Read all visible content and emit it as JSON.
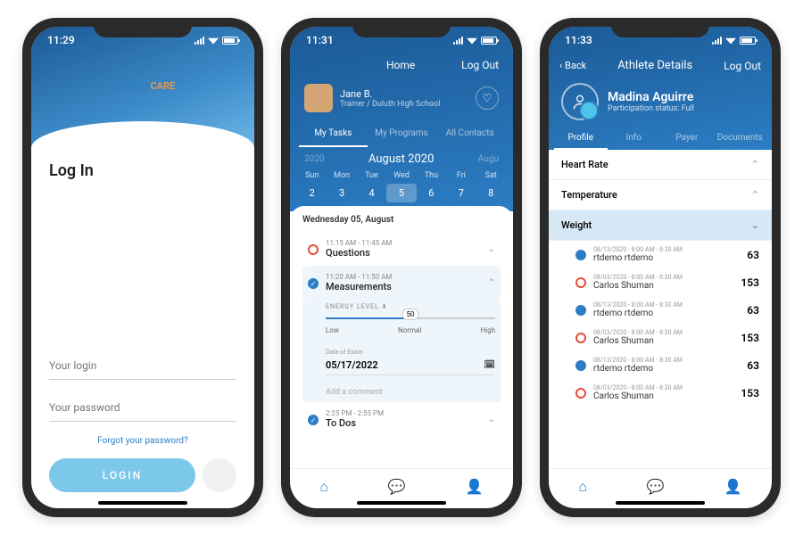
{
  "p1": {
    "time": "11:29",
    "logo_a": "Compete",
    "logo_b": "CARE",
    "title": "Log In",
    "login_ph": "Your login",
    "pass_ph": "Your password",
    "forgot": "Forgot your password?",
    "login_btn": "LOGIN"
  },
  "p2": {
    "time": "11:31",
    "home": "Home",
    "logout": "Log Out",
    "user": {
      "name": "Jane B.",
      "role": "Trainer",
      "school": "Duluth High School"
    },
    "tabs": [
      "My Tasks",
      "My Programs",
      "All Contacts"
    ],
    "month": "August 2020",
    "prev": "2020",
    "next": "Augu",
    "dow": [
      "Sun",
      "Mon",
      "Tue",
      "Wed",
      "Thu",
      "Fri",
      "Sat"
    ],
    "days": [
      "2",
      "3",
      "4",
      "5",
      "6",
      "7",
      "8"
    ],
    "date_label": "Wednesday 05, August",
    "tasks": [
      {
        "time": "11:15 AM - 11:45 AM",
        "title": "Questions"
      },
      {
        "time": "11:20 AM - 11:50 AM",
        "title": "Measurements"
      },
      {
        "time": "2:25 PM - 2:55 PM",
        "title": "To Dos"
      }
    ],
    "energy": {
      "label": "ENERGY LEVEL",
      "val": "50",
      "low": "Low",
      "normal": "Normal",
      "high": "High"
    },
    "exam": {
      "label": "Date of Exam",
      "date": "05/17/2022"
    },
    "add": "Add a comment"
  },
  "p3": {
    "time": "11:33",
    "back": "Back",
    "title": "Athlete Details",
    "logout": "Log Out",
    "name": "Madina Aguirre",
    "status_l": "Participation status:",
    "status_v": "Full",
    "tabs": [
      "Profile",
      "Info",
      "Payer",
      "Documents"
    ],
    "accordions": [
      "Heart Rate",
      "Temperature",
      "Weight"
    ],
    "entries": [
      {
        "dot": "b",
        "time": "08/13/2020 - 8:00 AM - 8:30 AM",
        "name": "rtdemo rtdemo",
        "val": "63"
      },
      {
        "dot": "r",
        "time": "08/03/2020 - 8:00 AM - 8:30 AM",
        "name": "Carlos Shuman",
        "val": "153"
      },
      {
        "dot": "b",
        "time": "08/13/2020 - 8:00 AM - 8:30 AM",
        "name": "rtdemo rtdemo",
        "val": "63"
      },
      {
        "dot": "r",
        "time": "08/03/2020 - 8:00 AM - 8:30 AM",
        "name": "Carlos Shuman",
        "val": "153"
      },
      {
        "dot": "b",
        "time": "08/13/2020 - 8:00 AM - 8:30 AM",
        "name": "rtdemo rtdemo",
        "val": "63"
      },
      {
        "dot": "r",
        "time": "08/03/2020 - 8:00 AM - 8:30 AM",
        "name": "Carlos Shuman",
        "val": "153"
      }
    ]
  }
}
